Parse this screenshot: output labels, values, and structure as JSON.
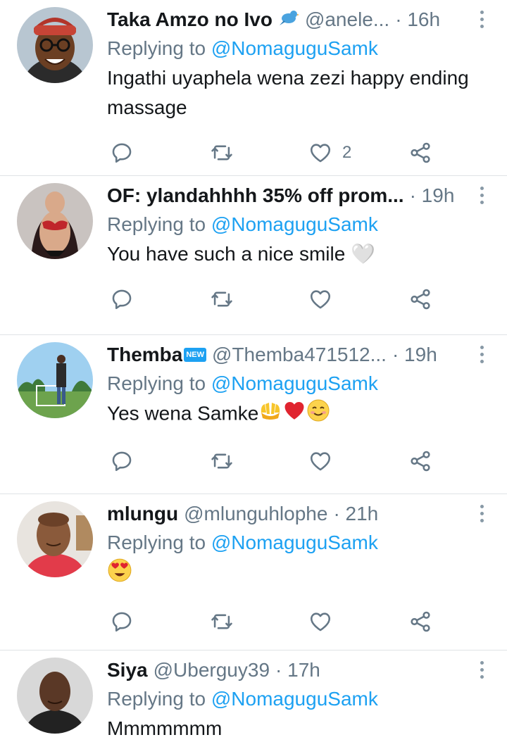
{
  "reply_prefix": "Replying to",
  "tweets": [
    {
      "name": "Taka Amzo no Ivo",
      "name_emoji": "bird-emoji",
      "handle": "@anele...",
      "time": "· 16h",
      "replying_to": "@NomaguguSamk",
      "text_line1": "Ingathi uyaphela wena zezi happy ending",
      "text_line2": "massage",
      "likes": "2"
    },
    {
      "name": "OF: ylandahhhh 35% off prom...",
      "handle": "",
      "time": "· 19h",
      "replying_to": "@NomaguguSamk",
      "text": "You have such a nice smile 🤍",
      "likes": ""
    },
    {
      "name": "Themba",
      "name_badge": "NEW",
      "handle": "@Themba471512...",
      "time": "· 19h",
      "replying_to": "@NomaguguSamk",
      "text": "Yes wena Samke",
      "text_emojis": [
        "palms-up-emoji",
        "red-heart-emoji",
        "smiling-face-emoji"
      ],
      "likes": ""
    },
    {
      "name": "mlungu",
      "handle": "@mlunguhlophe",
      "time": "· 21h",
      "replying_to": "@NomaguguSamk",
      "text": "",
      "text_emojis": [
        "heart-eyes-emoji"
      ],
      "likes": ""
    },
    {
      "name": "Siya",
      "handle": "@Uberguy39",
      "time": "· 17h",
      "replying_to": "@NomaguguSamk",
      "text": "Mmmmmmm",
      "likes": ""
    }
  ],
  "colors": {
    "text_primary": "#14171a",
    "text_secondary": "#657786",
    "link": "#1da1f2",
    "divider": "#dfe3e6"
  }
}
